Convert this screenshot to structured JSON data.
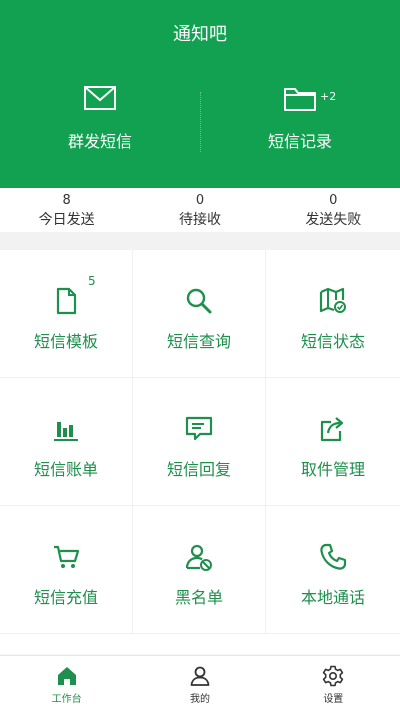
{
  "header": {
    "title": "通知吧",
    "left_button": {
      "label": "群发短信",
      "icon": "envelope-icon"
    },
    "right_button": {
      "label": "短信记录",
      "icon": "folder-icon",
      "badge": "+2"
    }
  },
  "stats": [
    {
      "value": "8",
      "label": "今日发送"
    },
    {
      "value": "0",
      "label": "待接收"
    },
    {
      "value": "0",
      "label": "发送失败"
    }
  ],
  "grid": {
    "items": [
      {
        "label": "短信模板",
        "icon": "document-icon",
        "badge": "5"
      },
      {
        "label": "短信查询",
        "icon": "search-icon"
      },
      {
        "label": "短信状态",
        "icon": "map-status-icon"
      },
      {
        "label": "短信账单",
        "icon": "bar-chart-icon"
      },
      {
        "label": "短信回复",
        "icon": "message-reply-icon"
      },
      {
        "label": "取件管理",
        "icon": "share-icon"
      },
      {
        "label": "短信充值",
        "icon": "cart-icon"
      },
      {
        "label": "黑名单",
        "icon": "user-blocked-icon"
      },
      {
        "label": "本地通话",
        "icon": "phone-icon"
      }
    ]
  },
  "tabbar": {
    "items": [
      {
        "label": "工作台",
        "icon": "home-icon",
        "active": true
      },
      {
        "label": "我的",
        "icon": "user-icon"
      },
      {
        "label": "设置",
        "icon": "gear-icon"
      }
    ]
  },
  "colors": {
    "primary": "#11a150",
    "accent_text": "#1f8f4d",
    "background": "#f5f5f5"
  }
}
